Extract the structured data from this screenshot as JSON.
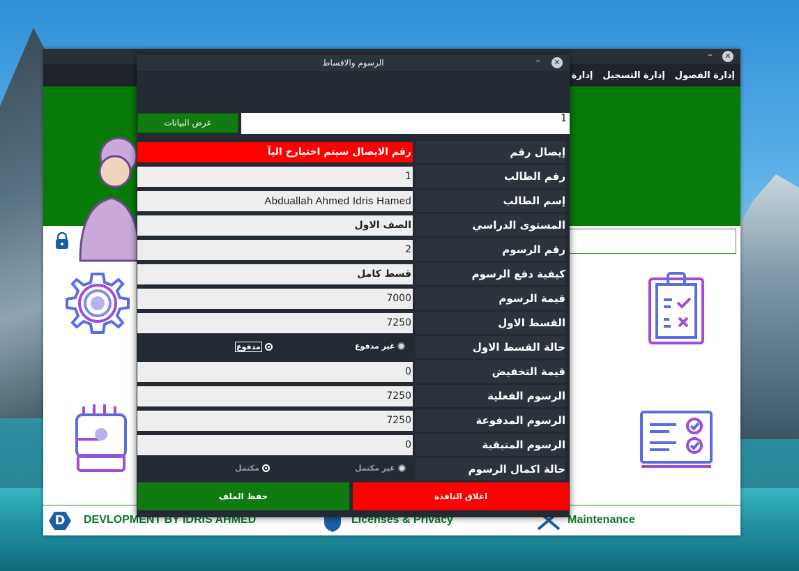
{
  "main": {
    "menu": [
      "إدارة الفصول",
      "إدارة التسجيل",
      "إدارة الر"
    ],
    "footer": {
      "dev_text": "DEVLOPMENT BY IDRIS AHMED",
      "license_text": "Licenses & Privacy",
      "maintenance_text": "Maintenance",
      "logo_letter": "D"
    }
  },
  "dialog": {
    "title": "الرسوم والاقساط",
    "search_value": "1",
    "show_button": "عرض البيانات",
    "fields": [
      {
        "label": "إيصال رقم",
        "value": "رقم الايصال سيتم اختيارخ اليآ"
      },
      {
        "label": "رقم الطالب",
        "value": "1"
      },
      {
        "label": "إسم الطالب",
        "value": "Abduallah Ahmed Idris Hamed"
      },
      {
        "label": "المستوى الدراسي",
        "value": "الصف الاول"
      },
      {
        "label": "رقم الرسوم",
        "value": "2"
      },
      {
        "label": "كيفية دفع الرسوم",
        "value": "قسط كامل"
      },
      {
        "label": "قيمة الرسوم",
        "value": "7000"
      },
      {
        "label": "القسط الاول",
        "value": "7250"
      }
    ],
    "first_installment_status": {
      "label": "حالة القسط الاول",
      "opt_unpaid": "غير مدفوع",
      "opt_paid": "مدفوع",
      "selected": "مدفوع"
    },
    "fields2": [
      {
        "label": "قيمة التخفيض",
        "value": "0"
      },
      {
        "label": "الرسوم الفعلية",
        "value": "7250"
      },
      {
        "label": "الرسوم المدفوعة",
        "value": "7250"
      },
      {
        "label": "الرسوم المتبقية",
        "value": "0"
      }
    ],
    "completion_status": {
      "label": "حالة اكمال الرسوم",
      "opt_incomplete": "غير مكتمل",
      "opt_complete": "مكتمل",
      "selected": "مكتمل"
    },
    "save_button": "حفظ الملف",
    "close_button": "اغلاق النافذة"
  },
  "colors": {
    "green": "#117a11",
    "red": "#ff0000",
    "dialog_bg": "#232a33"
  }
}
